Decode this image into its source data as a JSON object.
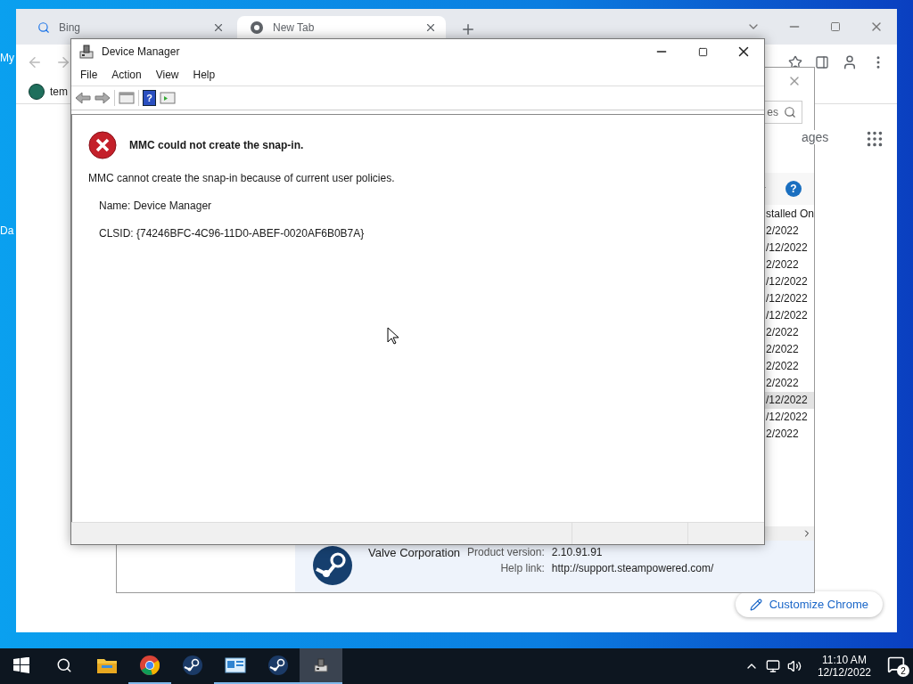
{
  "desktop": {
    "icons": [
      {
        "label": "My"
      },
      {
        "label": "Da"
      }
    ]
  },
  "browser": {
    "tabs": [
      {
        "label": "Bing",
        "kind": "search",
        "selected": false
      },
      {
        "label": "New Tab",
        "kind": "chrome",
        "selected": true
      }
    ],
    "bookmarks": [
      "tem"
    ],
    "apps_link": "ages",
    "customize_button": "Customize Chrome"
  },
  "programs": {
    "search_value": "es",
    "help_glyph": "?",
    "column": "stalled On",
    "rows": [
      {
        "date": "2/2022",
        "selected": false
      },
      {
        "date": "/12/2022",
        "selected": false
      },
      {
        "date": "2/2022",
        "selected": false
      },
      {
        "date": "/12/2022",
        "selected": false
      },
      {
        "date": "/12/2022",
        "selected": false
      },
      {
        "date": "/12/2022",
        "selected": false
      },
      {
        "date": "2/2022",
        "selected": false
      },
      {
        "date": "2/2022",
        "selected": false
      },
      {
        "date": "2/2022",
        "selected": false
      },
      {
        "date": "2/2022",
        "selected": false
      },
      {
        "date": "/12/2022",
        "selected": true
      },
      {
        "date": "/12/2022",
        "selected": false
      },
      {
        "date": "2/2022",
        "selected": false
      }
    ],
    "details": {
      "publisher": "Valve Corporation",
      "fields": [
        {
          "label": "Product version:",
          "value": "2.10.91.91"
        },
        {
          "label": "Help link:",
          "value": "http://support.steampowered.com/"
        }
      ]
    }
  },
  "device_manager": {
    "title": "Device Manager",
    "menu": [
      "File",
      "Action",
      "View",
      "Help"
    ],
    "help_glyph": "?",
    "error": {
      "title": "MMC could not create the snap-in.",
      "message": "MMC cannot create the snap-in because of current user policies.",
      "lines": [
        "Name: Device Manager",
        "CLSID: {74246BFC-4C96-11D0-ABEF-0020AF6B0B7A}"
      ]
    }
  },
  "taskbar": {
    "apps": [
      {
        "kind": "explorer",
        "running": false,
        "selected": false
      },
      {
        "kind": "chrome",
        "running": true,
        "selected": false
      },
      {
        "kind": "steam",
        "running": false,
        "selected": false
      },
      {
        "kind": "control",
        "running": true,
        "selected": false
      },
      {
        "kind": "steam",
        "running": true,
        "selected": false
      },
      {
        "kind": "devmgr",
        "running": true,
        "selected": true
      }
    ],
    "time": "11:10 AM",
    "date": "12/12/2022",
    "notifications": "2"
  }
}
